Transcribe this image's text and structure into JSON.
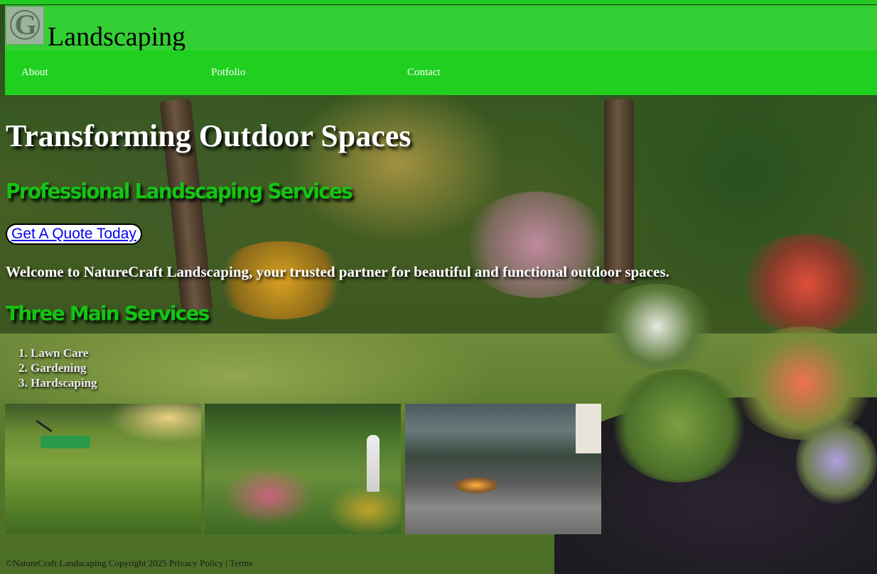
{
  "header": {
    "logo_letter": "G",
    "brand": "Landscaping"
  },
  "nav": {
    "items": [
      {
        "label": "About"
      },
      {
        "label": "Potfolio"
      },
      {
        "label": "Contact"
      }
    ]
  },
  "hero": {
    "title": "Transforming Outdoor Spaces",
    "subtitle": "Professional Landscaping Services",
    "cta_label": "Get A Quote Today",
    "welcome": "Welcome to NatureCraft Landscaping, your trusted partner for beautiful and functional outdoor spaces."
  },
  "services": {
    "title": "Three Main Services",
    "items": [
      "1. Lawn Care",
      "2. Gardening",
      "3. Hardscaping"
    ]
  },
  "footer": {
    "copyright": "©NatureCraft Landscaping Copyright 2025",
    "privacy": "Privacy Policy",
    "separator": "|",
    "terms": "Terms"
  },
  "colors": {
    "header_bg": "#34cf34",
    "nav_bg": "#1fd01f",
    "accent_green": "#14c414",
    "link_blue": "#0000ee"
  }
}
